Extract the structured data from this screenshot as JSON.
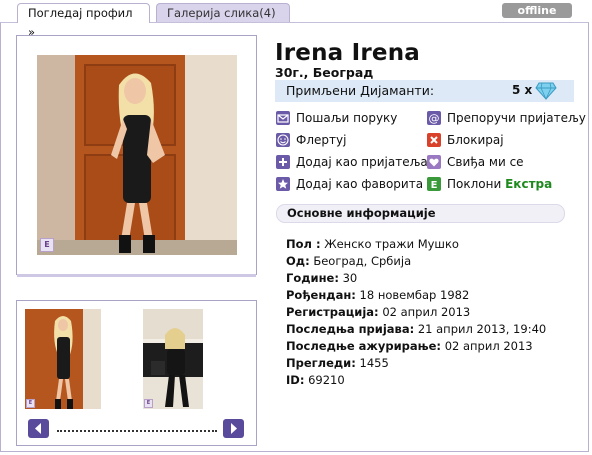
{
  "tabs": [
    {
      "label": "Погледај профил »"
    },
    {
      "label": "Галерија слика(4)"
    }
  ],
  "status_badge": "offline",
  "profile": {
    "name": "Irena Irena",
    "age_city": "30г.,  Београд"
  },
  "diamonds": {
    "label": "Примљени Дијаманти:",
    "count": "5 x",
    "icon": "diamond-icon"
  },
  "actions": [
    {
      "label": "Пошаљи поруку",
      "icon": "mail-icon",
      "color": "#6b5aa8"
    },
    {
      "label": "Препоручи пријатељу",
      "icon": "at-icon",
      "color": "#6b5aa8"
    },
    {
      "label": "Флертуј",
      "icon": "smiley-icon",
      "color": "#6b5aa8"
    },
    {
      "label": "Блокирај",
      "icon": "block-icon",
      "color": "#d9412b"
    },
    {
      "label": "Додај као пријатеља",
      "icon": "plus-icon",
      "color": "#6b5aa8"
    },
    {
      "label": "Свиђа ми се",
      "icon": "heart-icon",
      "color": "#9a79c2"
    },
    {
      "label": "Додај као фаворита",
      "icon": "star-icon",
      "color": "#6b5aa8"
    },
    {
      "label_prefix": "Поклони",
      "label_extra": "Екстра",
      "icon": "extra-icon",
      "color": "#3a9a3a"
    }
  ],
  "info": {
    "heading": "Основне информације",
    "rows": [
      {
        "label": "Пол :",
        "value": "Женско тражи Мушко"
      },
      {
        "label": "Од:",
        "value": "Београд, Србија"
      },
      {
        "label": "Године:",
        "value": "30"
      },
      {
        "label": "Рођендан:",
        "value": "18 новембар 1982"
      },
      {
        "label": "Регистрација:",
        "value": "02 април 2013"
      },
      {
        "label": "Последња пријава:",
        "value": "21 април 2013, 19:40"
      },
      {
        "label": "Последње ажурирање:",
        "value": "02 април 2013"
      },
      {
        "label": "Прегледи:",
        "value": "1455"
      },
      {
        "label": "ID:",
        "value": "69210"
      }
    ]
  },
  "photo_logo": "E",
  "colors": {
    "accent": "#5a4a9c",
    "tab_inactive": "#d9d3ec",
    "diamond_bar": "#dde9f7",
    "extra_green": "#1e8a1e"
  }
}
